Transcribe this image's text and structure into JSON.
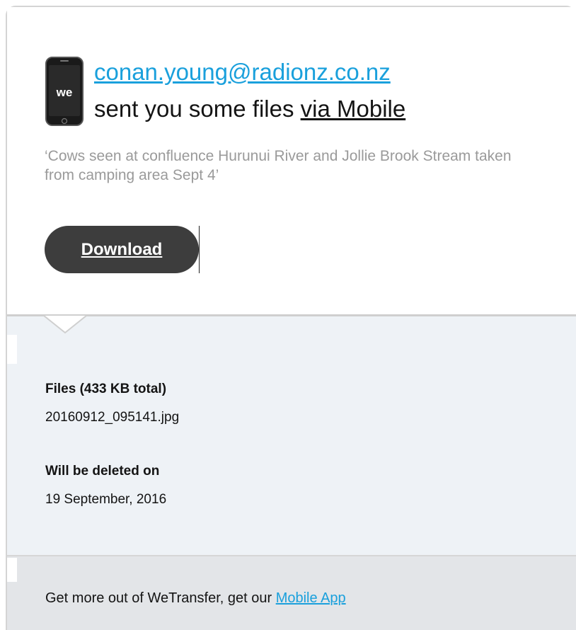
{
  "header": {
    "sender_email": "conan.young@radionz.co.nz",
    "sent_text": "sent you some files ",
    "via_text": "via Mobile",
    "icon": "wetransfer-mobile-icon",
    "icon_text": "we"
  },
  "message": "‘Cows seen at confluence Hurunui River and Jollie Brook Stream taken from camping area Sept 4’",
  "download_button": {
    "label": "Download"
  },
  "files": {
    "label": "Files (433 KB total)",
    "items": [
      "20160912_095141.jpg"
    ]
  },
  "deletion": {
    "label": "Will be deleted on",
    "date": "19 September, 2016"
  },
  "footer": {
    "text": "Get more out of WeTransfer, get our ",
    "link_label": "Mobile App"
  },
  "colors": {
    "link": "#1aa0dc",
    "button_bg": "#3d3d3d",
    "info_bg": "#eef2f6",
    "footer_bg": "#e3e5e8"
  }
}
